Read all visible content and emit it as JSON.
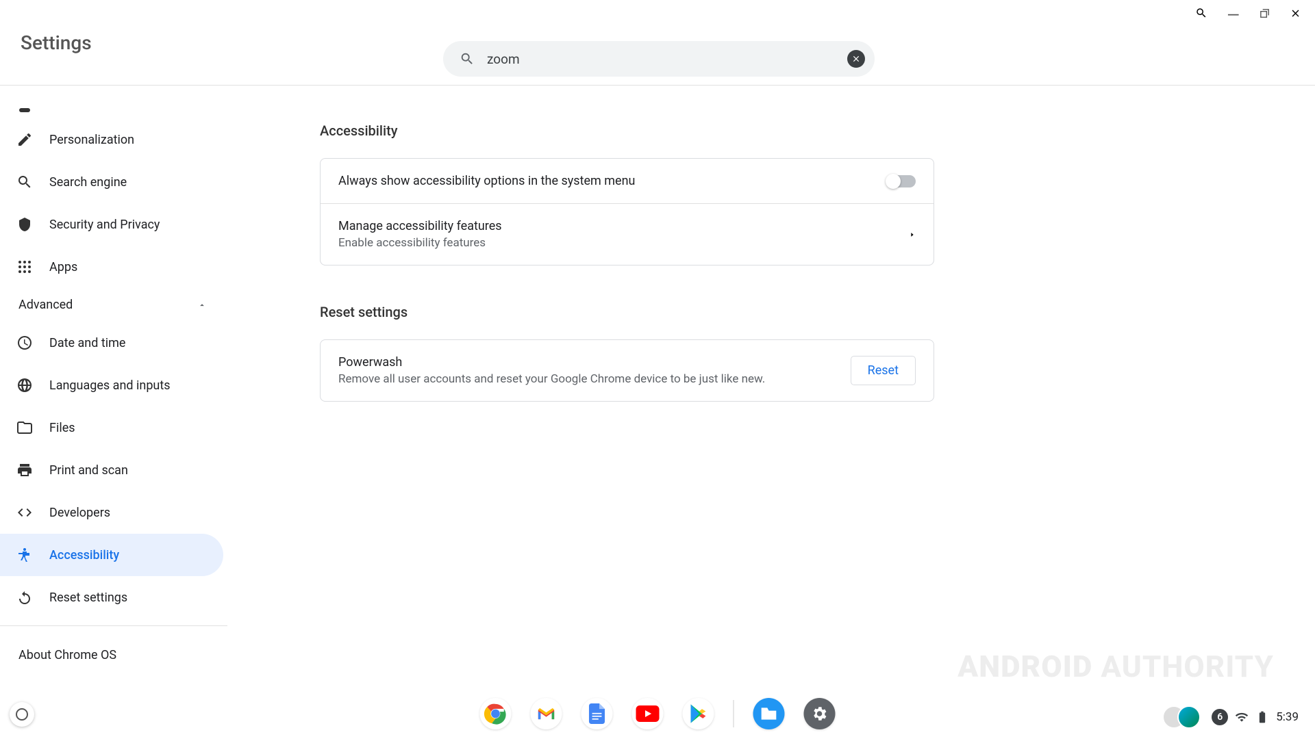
{
  "app_title": "Settings",
  "search": {
    "value": "zoom"
  },
  "sidebar": {
    "items": [
      {
        "label": "Personalization"
      },
      {
        "label": "Search engine"
      },
      {
        "label": "Security and Privacy"
      },
      {
        "label": "Apps"
      }
    ],
    "advanced_label": "Advanced",
    "advanced_expanded": true,
    "advanced_items": [
      {
        "label": "Date and time"
      },
      {
        "label": "Languages and inputs"
      },
      {
        "label": "Files"
      },
      {
        "label": "Print and scan"
      },
      {
        "label": "Developers"
      },
      {
        "label": "Accessibility",
        "active": true
      },
      {
        "label": "Reset settings"
      }
    ],
    "about_label": "About Chrome OS"
  },
  "content": {
    "accessibility": {
      "title": "Accessibility",
      "row1": "Always show accessibility options in the system menu",
      "row1_toggle_on": false,
      "row2_title": "Manage accessibility features",
      "row2_sub": "Enable accessibility features"
    },
    "reset": {
      "title": "Reset settings",
      "row_title": "Powerwash",
      "row_sub": "Remove all user accounts and reset your Google Chrome device to be just like new.",
      "button": "Reset"
    }
  },
  "tray": {
    "notif_count": "6",
    "time": "5:39"
  },
  "watermark": {
    "a": "ANDROID",
    "b": "AUTHORITY"
  }
}
